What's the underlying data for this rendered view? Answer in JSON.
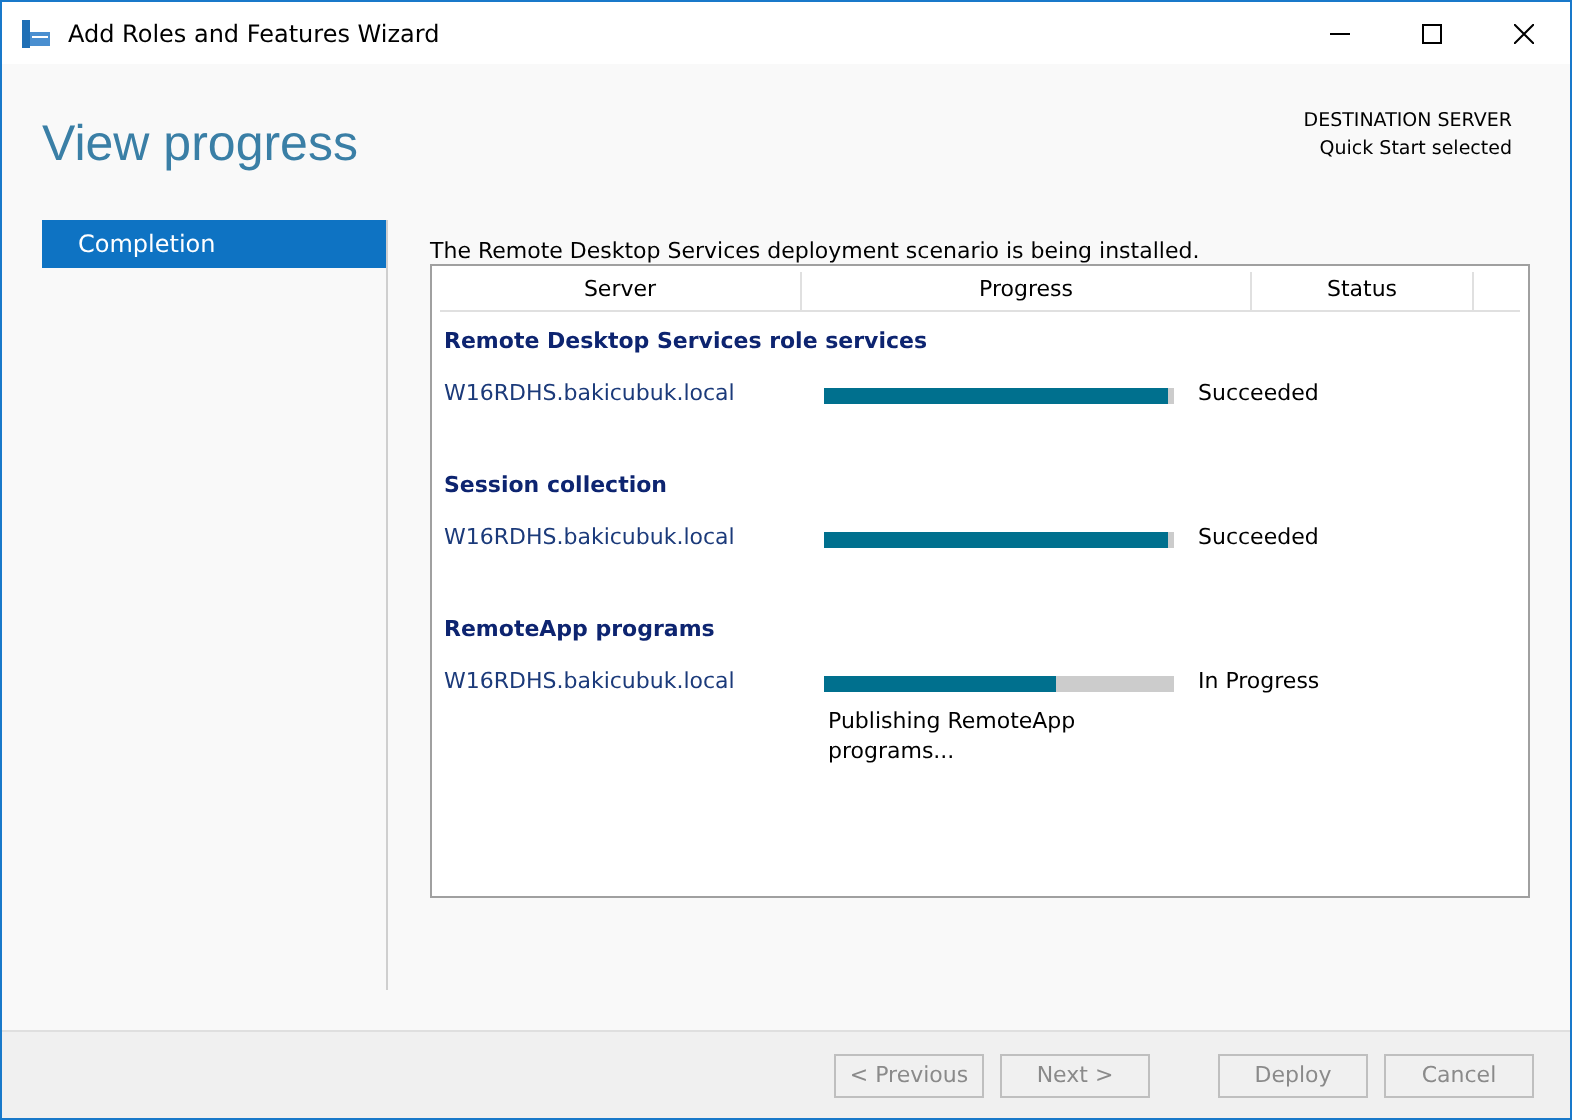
{
  "window": {
    "title": "Add Roles and Features Wizard"
  },
  "header": {
    "title": "View progress",
    "destination_label": "DESTINATION SERVER",
    "destination_value": "Quick Start selected"
  },
  "sidebar": {
    "items": [
      {
        "label": "Completion",
        "selected": true
      }
    ]
  },
  "message": "The Remote Desktop Services deployment scenario is being installed.",
  "table": {
    "columns": [
      "Server",
      "Progress",
      "Status"
    ],
    "groups": [
      {
        "title": "Remote Desktop Services role services",
        "rows": [
          {
            "server": "W16RDHS.bakicubuk.local",
            "level": 0.98,
            "status": "Succeeded"
          }
        ]
      },
      {
        "title": "Session collection",
        "rows": [
          {
            "server": "W16RDHS.bakicubuk.local",
            "level": 0.98,
            "status": "Succeeded"
          }
        ]
      },
      {
        "title": "RemoteApp programs",
        "rows": [
          {
            "server": "W16RDHS.bakicubuk.local",
            "level": 0.66,
            "status": "In Progress",
            "detail": "Publishing RemoteApp programs..."
          }
        ]
      }
    ]
  },
  "buttons": [
    {
      "label": "< Previous",
      "disabled": true
    },
    {
      "label": "Next >",
      "disabled": true
    },
    {
      "label": "Deploy",
      "disabled": true
    },
    {
      "label": "Cancel",
      "disabled": true
    }
  ]
}
